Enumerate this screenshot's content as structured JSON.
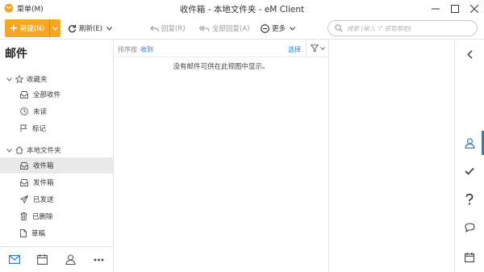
{
  "titlebar": {
    "menu_label": "菜单(M)",
    "window_title": "收件箱 - 本地文件夹 - eM Client"
  },
  "toolbar": {
    "new_label": "新建(N)",
    "refresh_label": "刷新(E)",
    "reply_label": "回复(R)",
    "reply_all_label": "全部回复(A)",
    "more_label": "更多",
    "search_placeholder": "搜索 (输入 '/' 获取帮助)"
  },
  "sidebar": {
    "title": "邮件",
    "favorites": {
      "label": "收藏夹",
      "items": [
        {
          "label": "全部收件",
          "icon": "inbox-icon"
        },
        {
          "label": "未读",
          "icon": "clock-icon"
        },
        {
          "label": "标记",
          "icon": "flag-icon"
        }
      ]
    },
    "local": {
      "label": "本地文件夹",
      "items": [
        {
          "label": "收件箱",
          "icon": "inbox-icon",
          "selected": true
        },
        {
          "label": "发件箱",
          "icon": "outbox-icon"
        },
        {
          "label": "已发送",
          "icon": "send-icon"
        },
        {
          "label": "已删除",
          "icon": "trash-icon"
        },
        {
          "label": "草稿",
          "icon": "document-icon"
        }
      ]
    },
    "bottom_nav": [
      "mail-icon",
      "calendar-icon",
      "contacts-icon",
      "more-icon"
    ]
  },
  "message_list": {
    "sort_label": "排序按",
    "sort_value": "收到",
    "select_label": "选择",
    "empty_text": "没有邮件可供在此视图中显示。"
  },
  "right_rail": [
    "collapse-icon",
    "contact-icon",
    "tasks-check-icon",
    "help-icon",
    "chat-icon",
    "calendar-icon"
  ],
  "colors": {
    "accent_orange": "#f5a623",
    "link_blue": "#2a7bc4"
  }
}
